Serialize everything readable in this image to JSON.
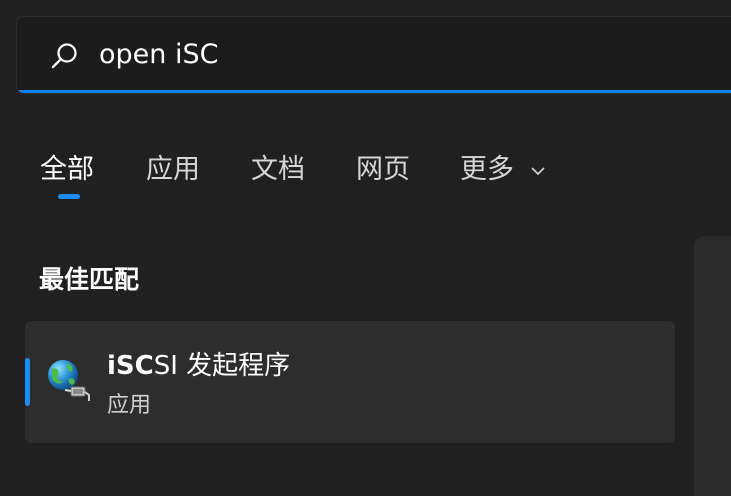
{
  "search": {
    "value": "open iSC",
    "placeholder": ""
  },
  "tabs": [
    {
      "label": "全部",
      "active": true
    },
    {
      "label": "应用"
    },
    {
      "label": "文档"
    },
    {
      "label": "网页"
    },
    {
      "label": "更多"
    }
  ],
  "best_match": {
    "title": "最佳匹配",
    "item": {
      "name_highlight": "iSC",
      "name_rest": "SI 发起程序",
      "type": "应用",
      "icon": "network-globe-icon"
    }
  },
  "colors": {
    "accent": "#1d8cf0",
    "background": "#202020",
    "card": "#2d2d2d"
  }
}
